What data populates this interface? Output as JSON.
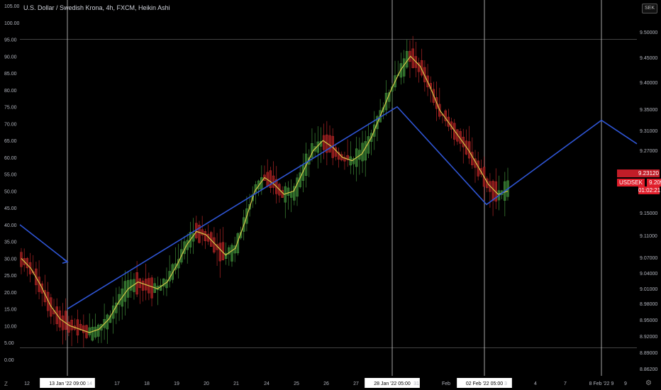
{
  "header": {
    "title": "U.S. Dollar / Swedish Krona, 4h, FXCM, Heikin Ashi",
    "currency_badge": "SEK"
  },
  "price_tags": {
    "symbol": "USDSEK",
    "last_price": "9.20913",
    "countdown": "01:02:21",
    "upper_price": "9.23120"
  },
  "colors": {
    "background": "#000000",
    "up_candle": "#2f6b2a",
    "down_candle": "#8b1a1a",
    "ma_line": "#d6c84a",
    "zigzag": "#2f55d4",
    "price_badge": "#e01e2b"
  },
  "chart_data": {
    "type": "candlestick",
    "title": "U.S. Dollar / Swedish Krona, 4h, FXCM, Heikin Ashi",
    "left_axis": {
      "ticks": [
        "105.00",
        "100.00",
        "95.00",
        "90.00",
        "85.00",
        "80.00",
        "75.00",
        "70.00",
        "65.00",
        "60.00",
        "55.00",
        "50.00",
        "45.00",
        "40.00",
        "35.00",
        "30.00",
        "25.00",
        "20.00",
        "15.00",
        "10.00",
        "5.00",
        "0.00"
      ],
      "range": [
        0,
        105
      ]
    },
    "right_axis": {
      "ticks": [
        "9.50000",
        "9.45000",
        "9.40000",
        "9.35000",
        "9.31000",
        "9.27000",
        "9.15000",
        "9.11000",
        "9.07000",
        "9.04000",
        "9.01000",
        "8.98000",
        "8.95000",
        "8.92000",
        "8.89000",
        "8.86200"
      ]
    },
    "x_axis": {
      "ticks": [
        "12",
        "13 Jan '22  09:00",
        "14",
        "17",
        "18",
        "19",
        "20",
        "21",
        "24",
        "25",
        "26",
        "27",
        "28 Jan '22  05:00",
        "31",
        "Feb",
        "02 Feb '22  05:00",
        "3",
        "4",
        "7",
        "8 Feb '22  9",
        "9"
      ],
      "highlighted": [
        "13 Jan '22  09:00",
        "28 Jan '22  05:00",
        "02 Feb '22  05:00",
        "08 Feb '22  9"
      ]
    },
    "oscillator_ma_series": {
      "name": "",
      "values": [
        30,
        27,
        22,
        16,
        12,
        10,
        9,
        8,
        9,
        12,
        17,
        21,
        23,
        22,
        21,
        23,
        28,
        34,
        38,
        37,
        34,
        31,
        33,
        41,
        50,
        54,
        52,
        49,
        50,
        56,
        62,
        65,
        63,
        60,
        59,
        61,
        66,
        73,
        80,
        86,
        90,
        87,
        81,
        74,
        70,
        66,
        62,
        57,
        52,
        49,
        50
      ]
    },
    "zigzag_series": {
      "name": "",
      "points": [
        {
          "x": "12",
          "y": 40
        },
        {
          "x": "13 Jan",
          "y": 29
        },
        {
          "x": "13 Jan",
          "y": 15
        },
        {
          "x": "28 Jan",
          "y": 75
        },
        {
          "x": "02 Feb",
          "y": 46
        },
        {
          "x": "08 Feb",
          "y": 71
        },
        {
          "x": "9",
          "y": 64
        }
      ]
    },
    "horizontal_levels": [
      95,
      3.5
    ],
    "vertical_markers": [
      "13 Jan '22  09:00",
      "28 Jan '22  05:00",
      "02 Feb '22  05:00",
      "08 Feb '22  9"
    ]
  }
}
